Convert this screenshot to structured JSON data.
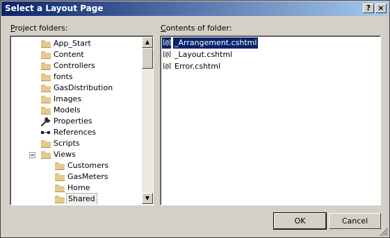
{
  "window": {
    "title": "Select a Layout Page",
    "help_button": "?",
    "close_button": "×"
  },
  "project_folders": {
    "label_accel": "P",
    "label_rest": "roject folders:",
    "items": [
      {
        "label": "App_Start",
        "icon": "folder-icon",
        "indent": 1
      },
      {
        "label": "Content",
        "icon": "folder-icon",
        "indent": 1
      },
      {
        "label": "Controllers",
        "icon": "folder-icon",
        "indent": 1
      },
      {
        "label": "fonts",
        "icon": "folder-icon",
        "indent": 1
      },
      {
        "label": "GasDistribution",
        "icon": "folder-icon",
        "indent": 1
      },
      {
        "label": "Images",
        "icon": "folder-icon",
        "indent": 1
      },
      {
        "label": "Models",
        "icon": "folder-icon",
        "indent": 1
      },
      {
        "label": "Properties",
        "icon": "wrench-icon",
        "indent": 1
      },
      {
        "label": "References",
        "icon": "references-icon",
        "indent": 1
      },
      {
        "label": "Scripts",
        "icon": "folder-icon",
        "indent": 1
      },
      {
        "label": "Views",
        "icon": "folder-icon",
        "indent": 1,
        "expanded": true
      },
      {
        "label": "Customers",
        "icon": "folder-icon",
        "indent": 2
      },
      {
        "label": "GasMeters",
        "icon": "folder-icon",
        "indent": 2
      },
      {
        "label": "Home",
        "icon": "folder-icon",
        "indent": 2
      },
      {
        "label": "Shared",
        "icon": "folder-icon",
        "indent": 2,
        "selected": true
      }
    ]
  },
  "contents_of_folder": {
    "label_accel": "C",
    "label_rest": "ontents of folder:",
    "files": [
      {
        "icon_text": "[@]",
        "name": "_Arrangement.cshtml",
        "selected": true
      },
      {
        "icon_text": "[@]",
        "name": "_Layout.cshtml",
        "selected": false
      },
      {
        "icon_text": "[@]",
        "name": "Error.cshtml",
        "selected": false
      }
    ]
  },
  "buttons": {
    "ok": "OK",
    "cancel": "Cancel"
  },
  "colors": {
    "title_gradient_start": "#0a246a",
    "title_gradient_end": "#a6caf0",
    "selection": "#0a246a",
    "folder": "#e6c98c",
    "dialog_bg": "#d4d0c8"
  }
}
